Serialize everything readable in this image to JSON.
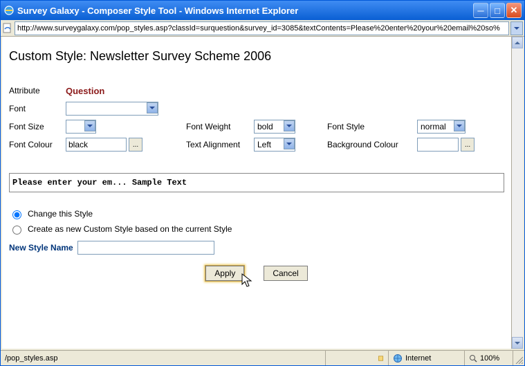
{
  "window": {
    "title": "Survey Galaxy - Composer Style Tool - Windows Internet Explorer"
  },
  "address": {
    "url": "http://www.surveygalaxy.com/pop_styles.asp?classId=surquestion&survey_id=3085&textContents=Please%20enter%20your%20email%20so%"
  },
  "page": {
    "title": "Custom Style: Newsletter Survey Scheme 2006",
    "labels": {
      "attribute": "Attribute",
      "attribute_value": "Question",
      "font": "Font",
      "font_size": "Font Size",
      "font_weight": "Font Weight",
      "font_style": "Font Style",
      "font_colour": "Font Colour",
      "text_alignment": "Text Alignment",
      "background_colour": "Background Colour",
      "new_style_name": "New Style Name"
    },
    "fields": {
      "font": "",
      "font_size": "",
      "font_weight": "bold",
      "font_style": "normal",
      "font_colour": "black",
      "text_alignment": "Left",
      "background_colour": "",
      "new_style_name": ""
    },
    "preview_text": "Please enter your em... Sample Text",
    "radios": {
      "change": "Change this Style",
      "create": "Create as new Custom Style based on the current Style",
      "selected": "change"
    },
    "buttons": {
      "apply": "Apply",
      "cancel": "Cancel",
      "browse": "..."
    }
  },
  "status": {
    "path": "/pop_styles.asp",
    "zone": "Internet",
    "zoom": "100%"
  }
}
